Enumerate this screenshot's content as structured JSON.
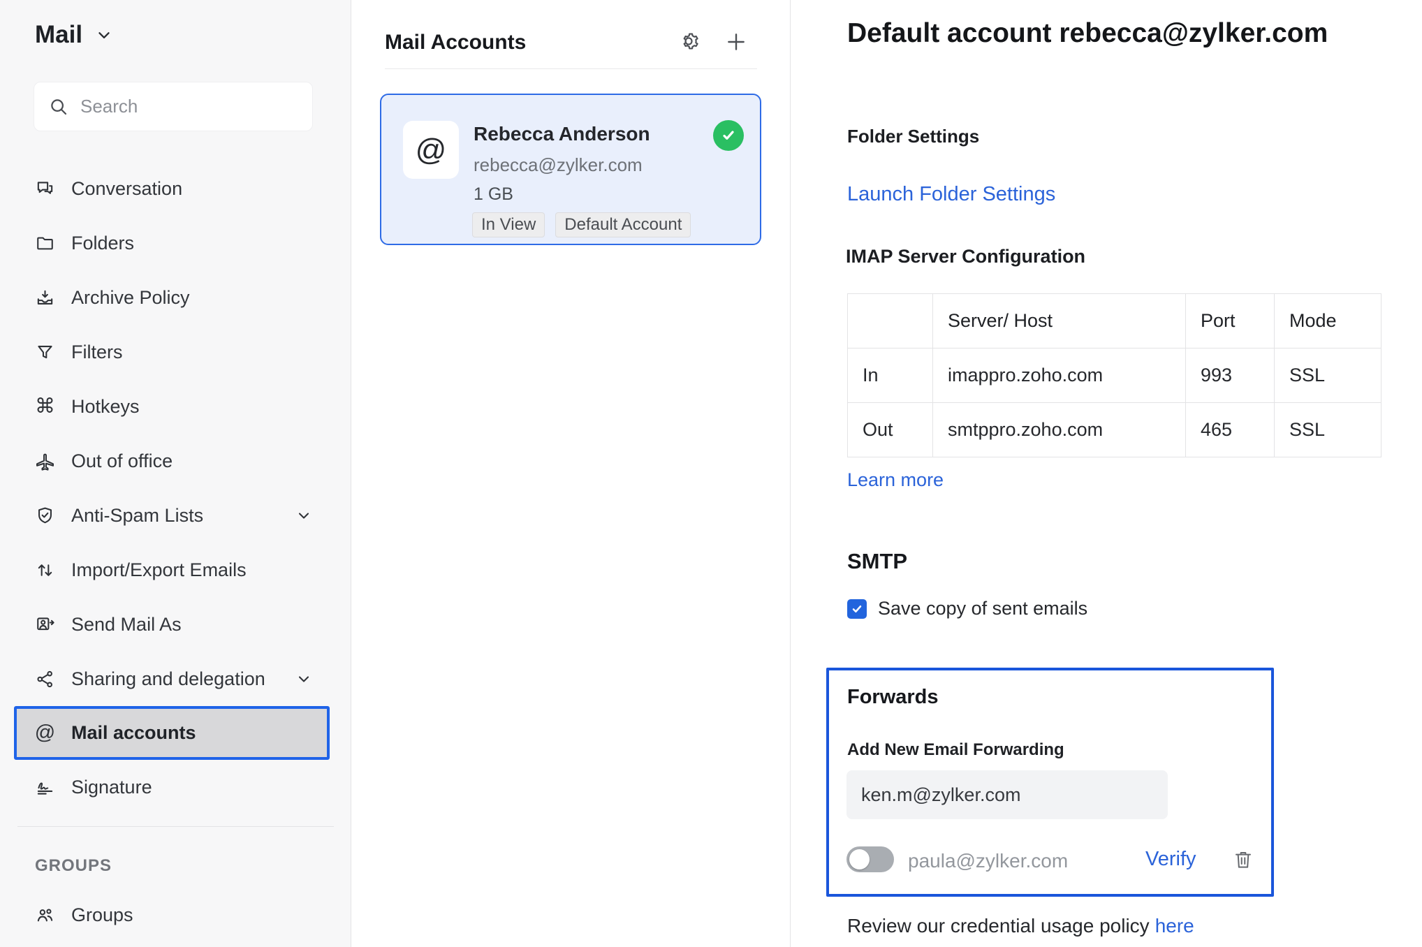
{
  "sidebar": {
    "app_title": "Mail",
    "search_placeholder": "Search",
    "items": [
      {
        "label": "Conversation"
      },
      {
        "label": "Folders"
      },
      {
        "label": "Archive Policy"
      },
      {
        "label": "Filters"
      },
      {
        "label": "Hotkeys"
      },
      {
        "label": "Out of office"
      },
      {
        "label": "Anti-Spam Lists",
        "has_chevron": true
      },
      {
        "label": "Import/Export Emails"
      },
      {
        "label": "Send Mail As"
      },
      {
        "label": "Sharing and delegation",
        "has_chevron": true
      },
      {
        "label": "Mail accounts",
        "selected": true
      },
      {
        "label": "Signature"
      }
    ],
    "groups_section_label": "GROUPS",
    "groups_item_label": "Groups"
  },
  "accounts_panel": {
    "title": "Mail Accounts",
    "account": {
      "name": "Rebecca Anderson",
      "email": "rebecca@zylker.com",
      "storage": "1 GB",
      "tags": [
        "In View",
        "Default Account"
      ],
      "status": "active"
    }
  },
  "details": {
    "title": "Default account rebecca@zylker.com",
    "folder_settings_heading": "Folder Settings",
    "folder_settings_link": "Launch Folder Settings",
    "imap_heading": "IMAP Server Configuration",
    "imap_table": {
      "headers": [
        "",
        "Server/ Host",
        "Port",
        "Mode"
      ],
      "rows": [
        [
          "In",
          "imappro.zoho.com",
          "993",
          "SSL"
        ],
        [
          "Out",
          "smtppro.zoho.com",
          "465",
          "SSL"
        ]
      ]
    },
    "learn_more_link": "Learn more",
    "smtp_heading": "SMTP",
    "smtp_checkbox_label": "Save copy of sent emails",
    "smtp_checkbox_checked": true,
    "forwards": {
      "heading": "Forwards",
      "add_label": "Add New Email Forwarding",
      "input_value": "ken.m@zylker.com",
      "pending_email": "paula@zylker.com",
      "toggle_state": "off",
      "verify_label": "Verify"
    },
    "policy_text": "Review our credential usage policy",
    "policy_link_label": "here"
  },
  "colors": {
    "accent_blue": "#1f63e8",
    "forwards_border_blue": "#1a56db",
    "link_blue": "#2b63d9",
    "card_border_blue": "#2e6be6",
    "card_bg": "#e9effc",
    "status_green": "#2abf62",
    "sidebar_bg": "#f7f7f8",
    "selected_item_bg": "#d8d8da",
    "toggle_off_gray": "#a9adb2"
  }
}
